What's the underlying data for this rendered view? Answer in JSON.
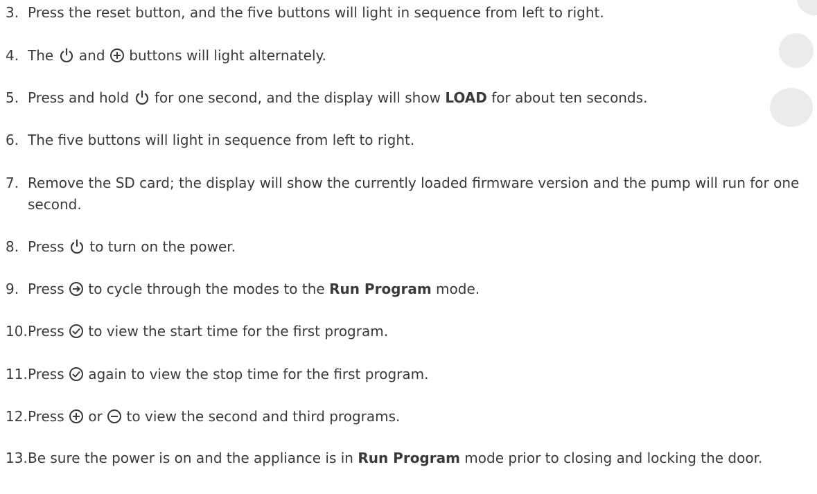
{
  "steps": [
    {
      "num": "3.",
      "a": "Press the reset button, and the five buttons will light in sequence from left to right."
    },
    {
      "num": "4.",
      "a": "The ",
      "b": " and ",
      "c": " buttons will light alternately."
    },
    {
      "num": "5.",
      "a": "Press and hold ",
      "b": " for one second, and the display will show ",
      "bold": "LOAD",
      "c": " for about ten seconds."
    },
    {
      "num": "6.",
      "a": "The five buttons will light in sequence from left to right."
    },
    {
      "num": "7.",
      "a": "Remove the SD card; the display will show the currently loaded firmware version and the pump will run for one second."
    },
    {
      "num": "8.",
      "a": "Press ",
      "b": " to turn on the power."
    },
    {
      "num": "9.",
      "a": "Press ",
      "b": " to cycle through the modes to the ",
      "bold": "Run Program",
      "c": " mode."
    },
    {
      "num": "10.",
      "a": "Press ",
      "b": " to view the start time for the first program."
    },
    {
      "num": "11.",
      "a": "Press ",
      "b": " again to view the stop time for the first program."
    },
    {
      "num": "12.",
      "a": "Press ",
      "b": " or ",
      "c": " to view the second and third programs."
    },
    {
      "num": "13.",
      "a": "Be sure the power is on and the appliance is in ",
      "bold": "Run Program",
      "b": " mode prior to closing and locking the door."
    }
  ],
  "icons": {
    "power": "power-icon",
    "plus": "plus-circle-icon",
    "minus": "minus-circle-icon",
    "next": "arrow-right-circle-icon",
    "check": "check-circle-icon"
  },
  "colors": {
    "text": "#3a3a3a",
    "decor": "#ebebeb"
  }
}
